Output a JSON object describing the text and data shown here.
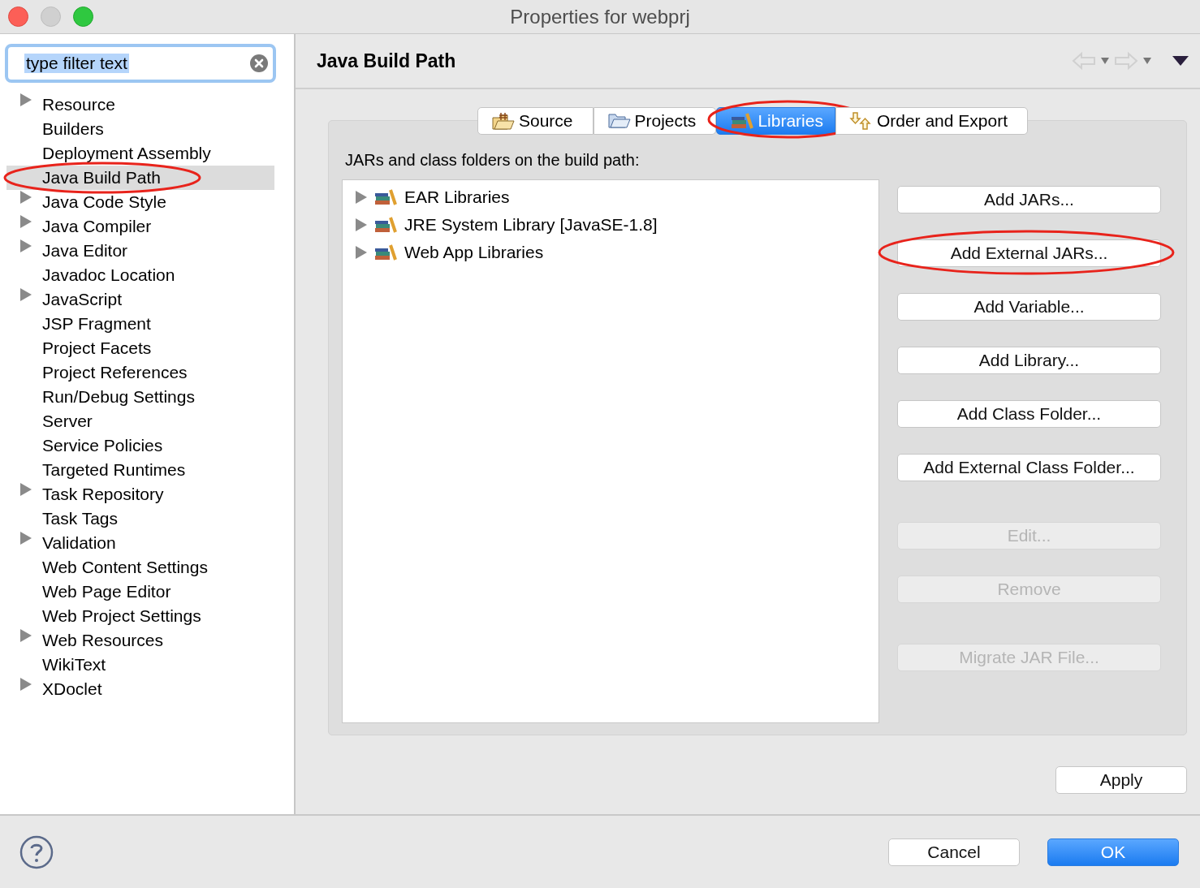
{
  "window": {
    "title": "Properties for webprj"
  },
  "filter": {
    "value": "type filter text",
    "text_selected": true
  },
  "tree": [
    {
      "label": "Resource",
      "expandable": true,
      "selected": false,
      "highlighted": false
    },
    {
      "label": "Builders",
      "expandable": false,
      "selected": false,
      "highlighted": false
    },
    {
      "label": "Deployment Assembly",
      "expandable": false,
      "selected": false,
      "highlighted": false
    },
    {
      "label": "Java Build Path",
      "expandable": false,
      "selected": true,
      "highlighted": true
    },
    {
      "label": "Java Code Style",
      "expandable": true,
      "selected": false,
      "highlighted": false
    },
    {
      "label": "Java Compiler",
      "expandable": true,
      "selected": false,
      "highlighted": false
    },
    {
      "label": "Java Editor",
      "expandable": true,
      "selected": false,
      "highlighted": false
    },
    {
      "label": "Javadoc Location",
      "expandable": false,
      "selected": false,
      "highlighted": false
    },
    {
      "label": "JavaScript",
      "expandable": true,
      "selected": false,
      "highlighted": false
    },
    {
      "label": "JSP Fragment",
      "expandable": false,
      "selected": false,
      "highlighted": false
    },
    {
      "label": "Project Facets",
      "expandable": false,
      "selected": false,
      "highlighted": false
    },
    {
      "label": "Project References",
      "expandable": false,
      "selected": false,
      "highlighted": false
    },
    {
      "label": "Run/Debug Settings",
      "expandable": false,
      "selected": false,
      "highlighted": false
    },
    {
      "label": "Server",
      "expandable": false,
      "selected": false,
      "highlighted": false
    },
    {
      "label": "Service Policies",
      "expandable": false,
      "selected": false,
      "highlighted": false
    },
    {
      "label": "Targeted Runtimes",
      "expandable": false,
      "selected": false,
      "highlighted": false
    },
    {
      "label": "Task Repository",
      "expandable": true,
      "selected": false,
      "highlighted": false
    },
    {
      "label": "Task Tags",
      "expandable": false,
      "selected": false,
      "highlighted": false
    },
    {
      "label": "Validation",
      "expandable": true,
      "selected": false,
      "highlighted": false
    },
    {
      "label": "Web Content Settings",
      "expandable": false,
      "selected": false,
      "highlighted": false
    },
    {
      "label": "Web Page Editor",
      "expandable": false,
      "selected": false,
      "highlighted": false
    },
    {
      "label": "Web Project Settings",
      "expandable": false,
      "selected": false,
      "highlighted": false
    },
    {
      "label": "Web Resources",
      "expandable": true,
      "selected": false,
      "highlighted": false
    },
    {
      "label": "WikiText",
      "expandable": false,
      "selected": false,
      "highlighted": false
    },
    {
      "label": "XDoclet",
      "expandable": true,
      "selected": false,
      "highlighted": false
    }
  ],
  "page": {
    "title": "Java Build Path"
  },
  "tabs": [
    {
      "label": "Source",
      "kind": "source",
      "selected": false,
      "highlighted": false
    },
    {
      "label": "Projects",
      "kind": "projects",
      "selected": false,
      "highlighted": false
    },
    {
      "label": "Libraries",
      "kind": "libraries",
      "selected": true,
      "highlighted": true
    },
    {
      "label": "Order and Export",
      "kind": "order",
      "selected": false,
      "highlighted": false
    }
  ],
  "list_label": "JARs and class folders on the build path:",
  "libraries": [
    {
      "label": "EAR Libraries"
    },
    {
      "label": "JRE System Library [JavaSE-1.8]"
    },
    {
      "label": "Web App Libraries"
    }
  ],
  "button_groups": [
    [
      {
        "label": "Add JARs...",
        "disabled": false,
        "highlighted": false
      },
      {
        "label": "Add External JARs...",
        "disabled": false,
        "highlighted": true
      },
      {
        "label": "Add Variable...",
        "disabled": false,
        "highlighted": false
      },
      {
        "label": "Add Library...",
        "disabled": false,
        "highlighted": false
      },
      {
        "label": "Add Class Folder...",
        "disabled": false,
        "highlighted": false
      },
      {
        "label": "Add External Class Folder...",
        "disabled": false,
        "highlighted": false
      }
    ],
    [
      {
        "label": "Edit...",
        "disabled": true,
        "highlighted": false
      },
      {
        "label": "Remove",
        "disabled": true,
        "highlighted": false
      }
    ],
    [
      {
        "label": "Migrate JAR File...",
        "disabled": true,
        "highlighted": false
      }
    ]
  ],
  "apply": "Apply",
  "footer": {
    "cancel": "Cancel",
    "ok": "OK"
  }
}
